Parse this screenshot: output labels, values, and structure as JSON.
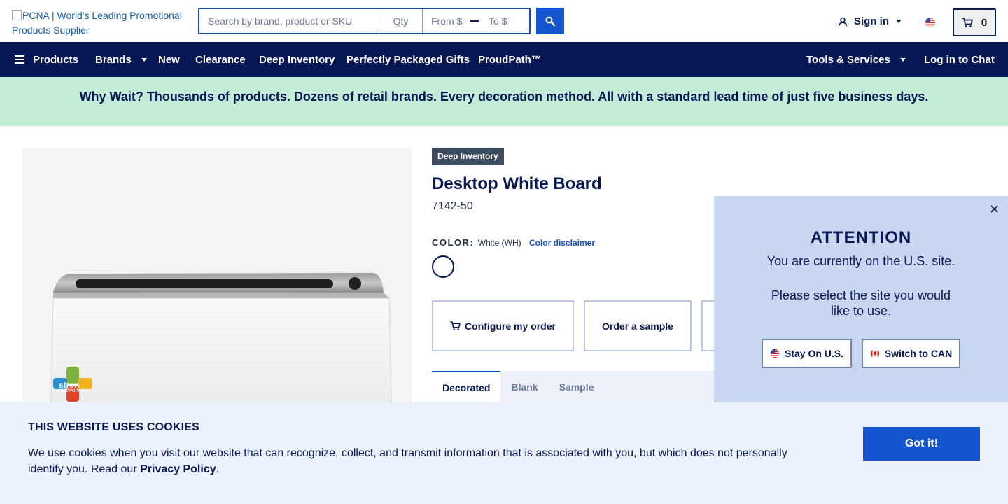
{
  "header": {
    "logo_alt": "PCNA | World's Leading Promotional Products Supplier",
    "search_placeholder": "Search by brand, product or SKU",
    "qty_placeholder": "Qty",
    "price_from_placeholder": "From $",
    "price_to_placeholder": "To $",
    "signin_label": "Sign in",
    "cart_count": "0",
    "icons": [
      "search-icon",
      "user-icon",
      "us-flag-icon",
      "cart-icon"
    ]
  },
  "nav": {
    "products": "Products",
    "brands": "Brands",
    "new": "New",
    "clearance": "Clearance",
    "deep_inventory": "Deep Inventory",
    "perfectly_packaged": "Perfectly Packaged Gifts",
    "proudpath": "ProudPath™",
    "tools": "Tools & Services",
    "chat": "Log in to Chat"
  },
  "promo": {
    "text": "Why Wait? Thousands of products. Dozens of retail brands. Every decoration method. All with a standard lead time of just five business days."
  },
  "product": {
    "badge": "Deep Inventory",
    "title": "Desktop White Board",
    "sku": "7142-50",
    "color_label": "COLOR:",
    "color_value": "White (WH)",
    "color_disclaimer": "Color disclaimer",
    "swatch_color": "#ffffff",
    "actions": {
      "configure": "Configure my order",
      "sample": "Order a sample"
    },
    "tabs": [
      "Decorated",
      "Blank",
      "Sample"
    ],
    "image_logo_text": [
      "stren",
      "network"
    ]
  },
  "site_modal": {
    "title": "ATTENTION",
    "line1": "You are currently on the U.S. site.",
    "line2a": "Please select the site you would",
    "line2b": "like to use.",
    "stay_label": "Stay On U.S.",
    "switch_label": "Switch to CAN"
  },
  "cookie": {
    "title": "THIS WEBSITE USES COOKIES",
    "body": "We use cookies when you visit our website that can recognize, collect, and transmit information that is associated with you, but which does not personally identify you. Read our ",
    "privacy_link": "Privacy Policy",
    "body_end": ".",
    "button": "Got it!"
  },
  "colors": {
    "navy": "#061754",
    "accent_blue": "#1556d0",
    "promo_green": "#c2ecd6",
    "modal_bg": "#c9d6ef",
    "cookie_bg": "#ecf2fb"
  }
}
